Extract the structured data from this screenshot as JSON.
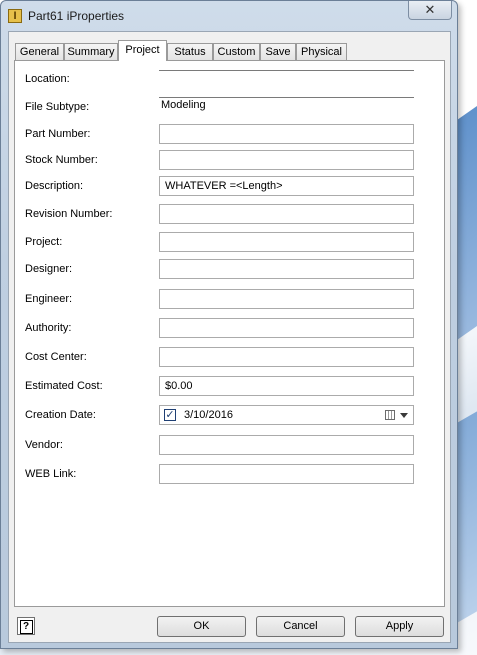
{
  "window": {
    "title": "Part61 iProperties",
    "close_glyph": "✕"
  },
  "tabs": [
    {
      "label": "General"
    },
    {
      "label": "Summary"
    },
    {
      "label": "Project",
      "active": true
    },
    {
      "label": "Status"
    },
    {
      "label": "Custom"
    },
    {
      "label": "Save"
    },
    {
      "label": "Physical"
    }
  ],
  "fields": {
    "location": {
      "label": "Location:",
      "value": ""
    },
    "file_subtype": {
      "label": "File Subtype:",
      "value": "Modeling"
    },
    "part_number": {
      "label": "Part Number:",
      "value": ""
    },
    "stock_number": {
      "label": "Stock Number:",
      "value": ""
    },
    "description": {
      "label": "Description:",
      "value": "WHATEVER =<Length>"
    },
    "revision_number": {
      "label": "Revision Number:",
      "value": ""
    },
    "project": {
      "label": "Project:",
      "value": ""
    },
    "designer": {
      "label": "Designer:",
      "value": ""
    },
    "engineer": {
      "label": "Engineer:",
      "value": ""
    },
    "authority": {
      "label": "Authority:",
      "value": ""
    },
    "cost_center": {
      "label": "Cost Center:",
      "value": ""
    },
    "estimated_cost": {
      "label": "Estimated Cost:",
      "value": "$0.00"
    },
    "creation_date": {
      "label": "Creation Date:",
      "value": "3/10/2016",
      "checked": true,
      "check_glyph": "✓"
    },
    "vendor": {
      "label": "Vendor:",
      "value": ""
    },
    "web_link": {
      "label": "WEB Link:",
      "value": ""
    }
  },
  "buttons": {
    "help": "?",
    "ok": "OK",
    "cancel": "Cancel",
    "apply": "Apply"
  },
  "colors": {
    "title_bar": "#c3d2e4",
    "dialog_bg": "#f0f0f0",
    "panel_bg": "#ffffff",
    "field_border": "#ababab"
  }
}
